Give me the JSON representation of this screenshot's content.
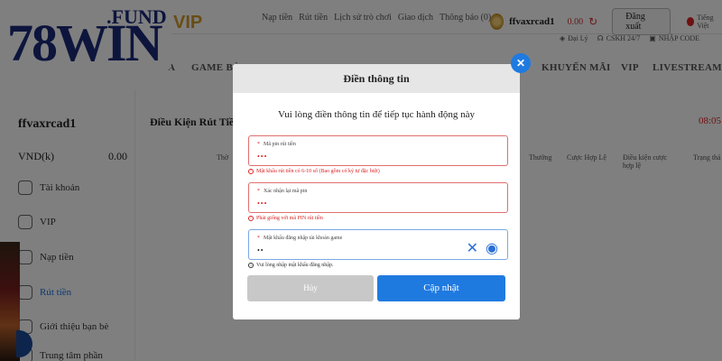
{
  "logo": {
    "main": "78WIN",
    "sub": ".FUND"
  },
  "topbar": {
    "vip_label": "VIP",
    "links": [
      "Nạp tiền",
      "Rút tiền",
      "Lịch sử trò chơi",
      "Giao dịch",
      "Thông báo (0)"
    ],
    "username": "ffvaxrcad1",
    "balance": "0.00",
    "logout": "Đăng xuất",
    "language": "Tiếng Việt"
  },
  "subbar": {
    "items": [
      "Đại Lý",
      "CSKH 24/7",
      "NHẬP CODE"
    ]
  },
  "nav": {
    "items": [
      "A",
      "GAME BÀ",
      "KHUYẾN MÃI",
      "VIP",
      "LIVESTREAM"
    ]
  },
  "sidebar": {
    "username": "ffvaxrcad1",
    "currency": "VND(k)",
    "balance": "0.00",
    "items": [
      {
        "label": "Tài khoản",
        "icon": "account-icon"
      },
      {
        "label": "VIP",
        "icon": "vip-icon"
      },
      {
        "label": "Nạp tiền",
        "icon": "deposit-icon"
      },
      {
        "label": "Rút tiền",
        "icon": "withdraw-icon"
      },
      {
        "label": "Giới thiệu bạn bè",
        "icon": "referral-icon"
      },
      {
        "label": "Trung tâm phần",
        "icon": "center-icon"
      }
    ]
  },
  "main": {
    "title": "Điều Kiện Rút Tiề",
    "time": "08:05",
    "columns": [
      "Thờ",
      "Thưởng",
      "Cược Hợp Lệ",
      "Điều kiện cược hợp lệ",
      "Trạng thá"
    ]
  },
  "modal": {
    "title": "Điền thông tin",
    "subtitle": "Vui lòng điền thông tin để tiếp tục hành động này",
    "fields": [
      {
        "label": "Mã pin rút tiền",
        "value": "•••",
        "hint": "Mật khẩu rút tiền có 6-10 số (Bao gồm có ký tự đặc biệt)"
      },
      {
        "label": "Xác nhận lại mã pin",
        "value": "•••",
        "hint": "Phải giống với mã PIN rút tiền"
      },
      {
        "label": "Mật khẩu đăng nhập tài khoản game",
        "value": "••",
        "hint": "Vui lòng nhập mật khẩu đăng nhập."
      }
    ],
    "cancel": "Hủy",
    "submit": "Cập nhật"
  },
  "colors": {
    "accent": "#1f7ae0",
    "error": "#dd2222",
    "brand": "#1b2a7a"
  }
}
